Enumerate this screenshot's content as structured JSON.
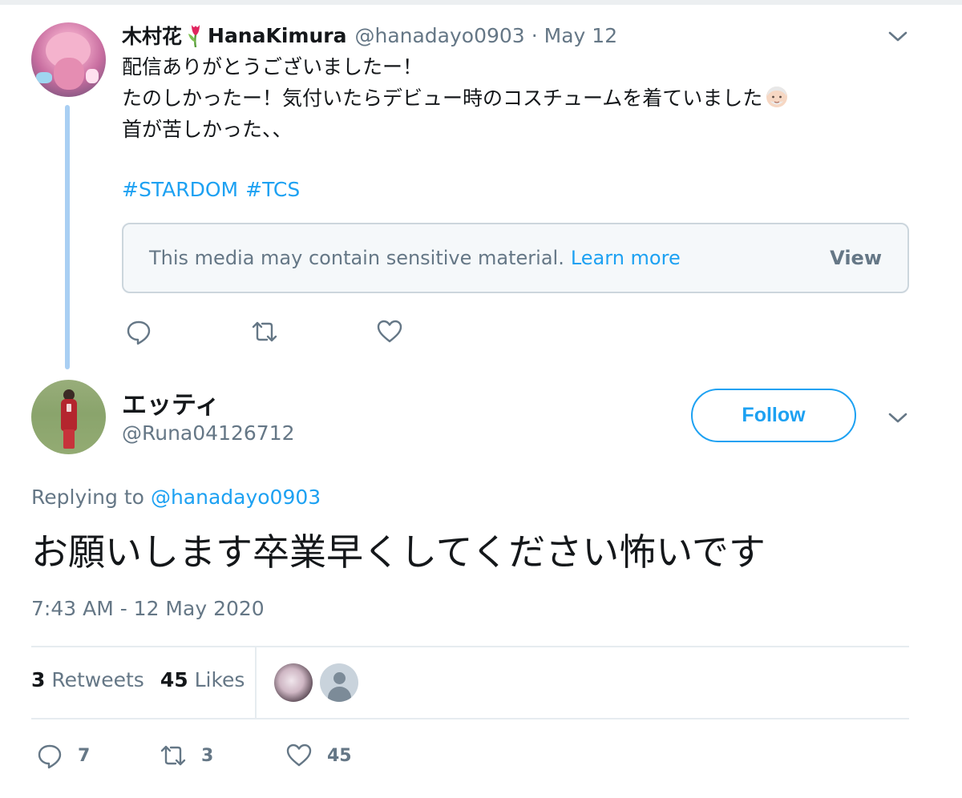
{
  "parent_tweet": {
    "display_name": "木村花",
    "display_name_en": "HanaKimura",
    "handle": "@hanadayo0903",
    "separator": "·",
    "date": "May 12",
    "text_lines": [
      "配信ありがとうございましたー！",
      "たのしかったー！気付いたらデビュー時のコスチュームを着ていました",
      "首が苦しかった、、"
    ],
    "hashtags": [
      "#STARDOM",
      "#TCS"
    ],
    "sensitive_notice": "This media may contain sensitive material.",
    "learn_more": "Learn more",
    "view_label": "View",
    "actions": [
      "reply-icon",
      "retweet-icon",
      "like-icon"
    ]
  },
  "reply_tweet": {
    "display_name": "エッティ",
    "handle": "@Runa04126712",
    "follow_label": "Follow",
    "replying_to_prefix": "Replying to",
    "replying_to_handle": "@hanadayo0903",
    "text": "お願いします卒業早くしてください怖いです",
    "timestamp": "7:43 AM - 12 May 2020",
    "stats": {
      "retweets_count": "3",
      "retweets_label": "Retweets",
      "likes_count": "45",
      "likes_label": "Likes"
    },
    "bottom_actions": {
      "reply_count": "7",
      "retweet_count": "3",
      "like_count": "45"
    }
  },
  "colors": {
    "accent": "#1da1f2",
    "muted_text": "#657786",
    "primary_text": "#14171a",
    "thread_line": "#a9cff3",
    "divider": "#e6ecf0"
  }
}
